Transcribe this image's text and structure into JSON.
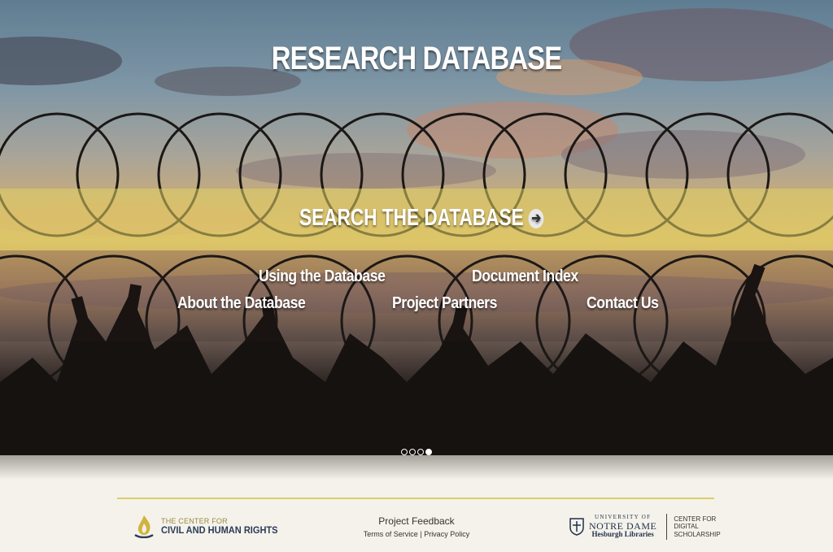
{
  "hero": {
    "title": "RESEARCH DATABASE",
    "search_label": "SEARCH THE DATABASE",
    "search_icon": "arrow-right-circle-icon"
  },
  "nav": {
    "using": "Using the Database",
    "index": "Document Index",
    "about": "About the Database",
    "partners": "Project Partners",
    "contact": "Contact Us"
  },
  "carousel": {
    "slides": 4,
    "active_slide": 4
  },
  "footer": {
    "cchr_line1": "THE CENTER FOR",
    "cchr_line2": "CIVIL AND HUMAN RIGHTS",
    "feedback": "Project Feedback",
    "terms": "Terms of Service",
    "separator": "|",
    "privacy": "Privacy Policy",
    "nd_university": "UNIVERSITY OF",
    "nd_name": "NOTRE DAME",
    "nd_libraries": "Hesburgh Libraries",
    "cds_line1": "CENTER for",
    "cds_line2": "DIGITAL",
    "cds_line3": "SCHOLARSHIP"
  },
  "colors": {
    "accent_gold": "#d9ce6c",
    "navy": "#2a3b57",
    "band": "#e0d264"
  }
}
